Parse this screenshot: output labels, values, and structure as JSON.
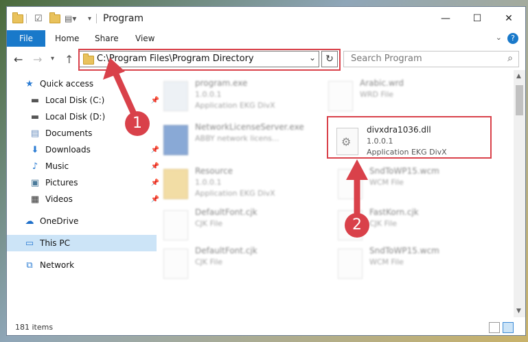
{
  "window": {
    "title": "Program"
  },
  "ribbon": {
    "file": "File",
    "home": "Home",
    "share": "Share",
    "view": "View",
    "help": "?"
  },
  "address": {
    "path": "C:\\Program Files\\Program Directory"
  },
  "search": {
    "placeholder": "Search Program"
  },
  "sidebar": {
    "items": [
      {
        "label": "Quick access",
        "icon": "star-icon"
      },
      {
        "label": "Local Disk (C:)",
        "icon": "drive-icon"
      },
      {
        "label": "Local Disk (D:)",
        "icon": "drive-icon"
      },
      {
        "label": "Documents",
        "icon": "documents-icon"
      },
      {
        "label": "Downloads",
        "icon": "download-icon"
      },
      {
        "label": "Music",
        "icon": "music-icon"
      },
      {
        "label": "Pictures",
        "icon": "pictures-icon"
      },
      {
        "label": "Videos",
        "icon": "videos-icon"
      },
      {
        "label": "OneDrive",
        "icon": "cloud-icon"
      },
      {
        "label": "This PC",
        "icon": "computer-icon"
      },
      {
        "label": "Network",
        "icon": "network-icon"
      }
    ]
  },
  "files": {
    "program_exe": {
      "name": "program.exe",
      "version": "1.0.0.1",
      "type": "Application EKG DivX"
    },
    "arabic": {
      "name": "Arabic.wrd",
      "type": "WRD File"
    },
    "netlicense": {
      "name": "NetworkLicenseServer.exe",
      "type": "ABBY network licens..."
    },
    "divx": {
      "name": "divxdra1036.dll",
      "version": "1.0.0.1",
      "type": "Application EKG DivX"
    },
    "resource": {
      "name": "Resource",
      "version": "1.0.0.1",
      "type": "Application EKG DivX"
    },
    "sndtowp15": {
      "name": "SndToWP15.wcm",
      "type": "WCM File"
    },
    "defaultfont1": {
      "name": "DefaultFont.cjk",
      "type": "CJK File"
    },
    "fastkorn": {
      "name": "FastKorn.cjk",
      "type": "CJK File"
    },
    "defaultfont2": {
      "name": "DefaultFont.cjk",
      "type": "CJK File"
    },
    "sndtowp15b": {
      "name": "SndToWP15.wcm",
      "type": "WCM File"
    }
  },
  "status": {
    "count": "181 items"
  },
  "annotations": {
    "step1": "1",
    "step2": "2",
    "accent": "#d9414a"
  }
}
